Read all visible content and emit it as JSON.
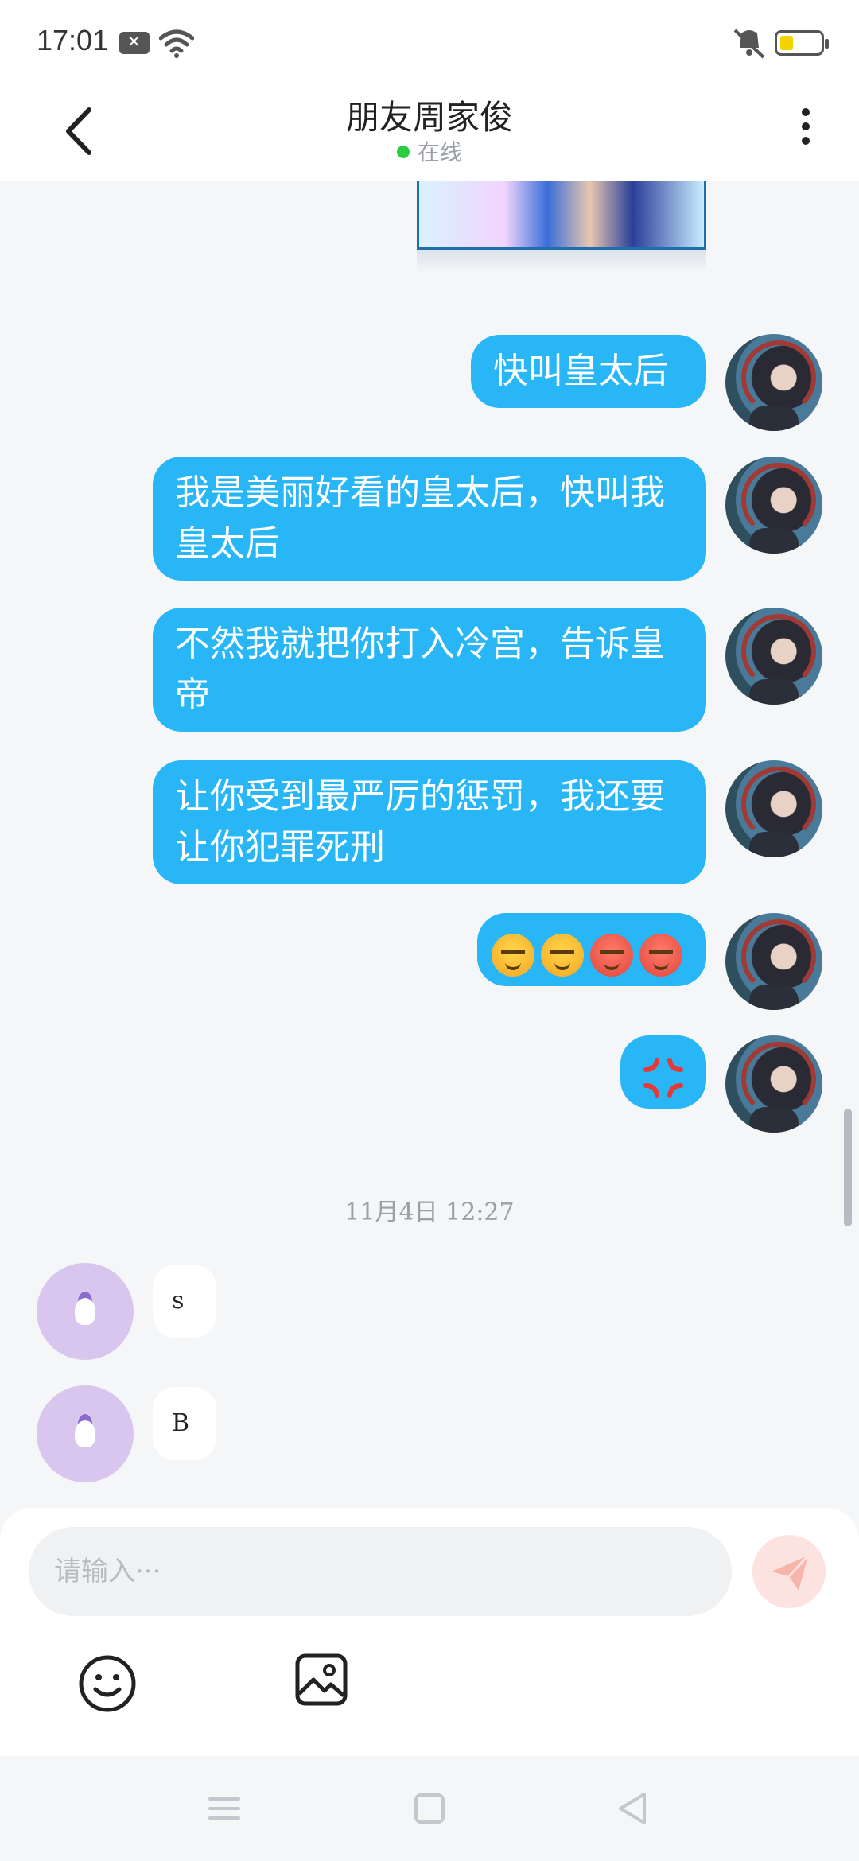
{
  "status_bar": {
    "time": "17:01"
  },
  "header": {
    "title": "朋友周家俊",
    "status": "在线"
  },
  "messages": [
    {
      "side": "out",
      "text": "快叫皇太后"
    },
    {
      "side": "out",
      "text": "我是美丽好看的皇太后，快叫我皇太后"
    },
    {
      "side": "out",
      "text": "不然我就把你打入冷宫，告诉皇帝"
    },
    {
      "side": "out",
      "text": "让你受到最严厉的惩罚，我还要让你犯罪死刑"
    },
    {
      "side": "out",
      "emojis": [
        "unamused-face-emoji",
        "unamused-face-emoji",
        "angry-face-emoji",
        "angry-face-emoji"
      ]
    },
    {
      "side": "out",
      "emojis": [
        "anger-symbol-emoji"
      ]
    }
  ],
  "timestamp": "11月4日 12:27",
  "incoming": [
    {
      "side": "in",
      "text": "s"
    },
    {
      "side": "in",
      "text": "B"
    }
  ],
  "input": {
    "placeholder": "请输入···"
  },
  "colors": {
    "outgoing_bubble": "#29b6f6",
    "incoming_bubble": "#ffffff",
    "online_dot": "#2ecc40",
    "send_button": "#fde3e0",
    "background": "#f4f6f8"
  },
  "icons": {
    "back": "chevron-left-icon",
    "more": "more-vertical-icon",
    "emoji": "smiley-icon",
    "image": "image-icon",
    "send": "paper-plane-icon"
  }
}
